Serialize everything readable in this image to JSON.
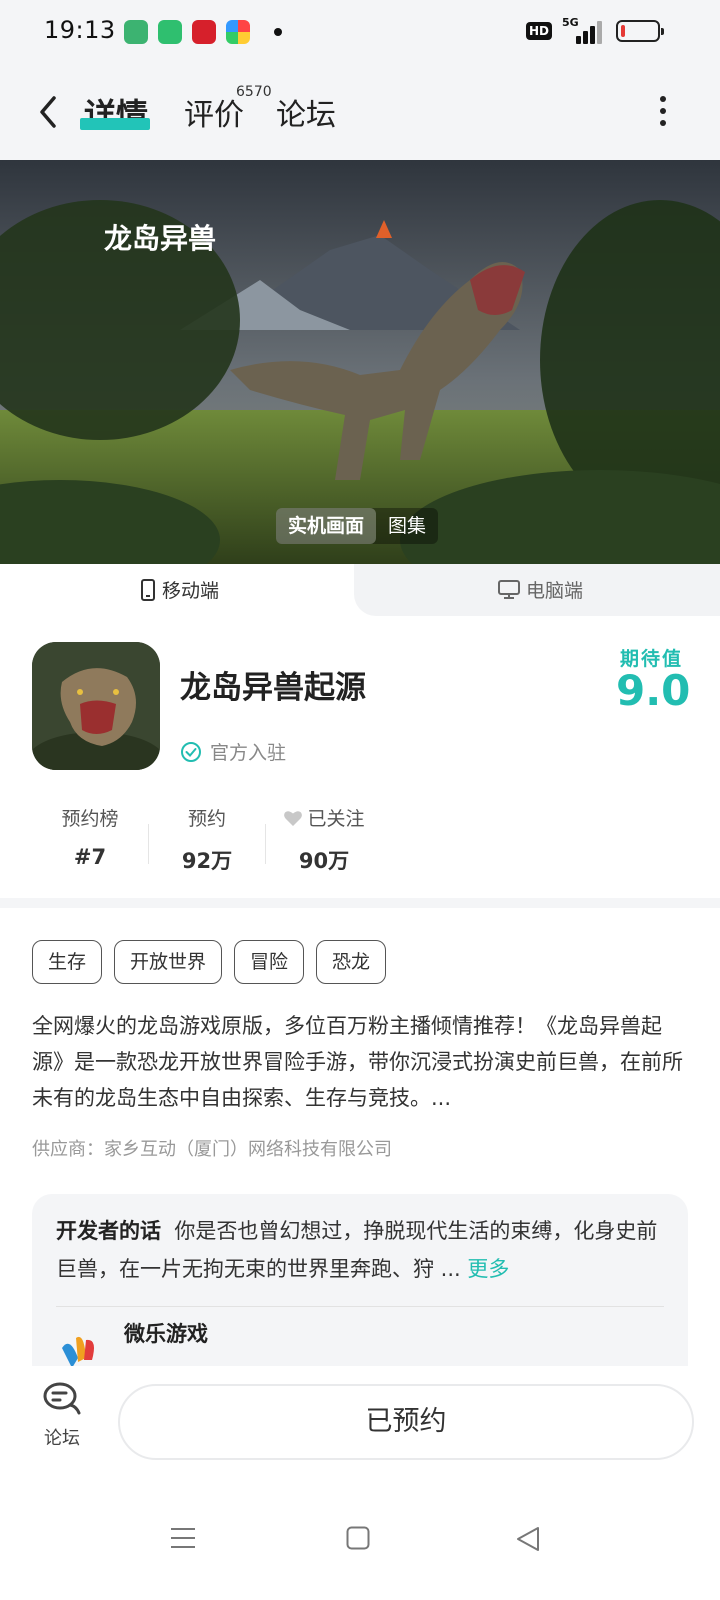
{
  "status_bar": {
    "time": "19:13",
    "hd": "HD",
    "network": "5G",
    "battery_level": 0.1,
    "notification_icons": [
      "app-store-icon",
      "battery-app-icon",
      "red-app-icon",
      "photos-icon"
    ]
  },
  "header": {
    "tabs": [
      {
        "label": "详情",
        "active": true
      },
      {
        "label": "评价"
      },
      {
        "label": "论坛"
      }
    ],
    "review_count": "6570"
  },
  "banner": {
    "toggle": [
      "实机画面",
      "图集"
    ],
    "active_toggle": "实机画面"
  },
  "platform": {
    "mobile": "移动端",
    "pc": "电脑端"
  },
  "app": {
    "name": "龙岛异兽起源",
    "official": "官方入驻",
    "expect_label": "期待值",
    "expect_score": "9.0"
  },
  "stats": [
    {
      "label": "预约榜",
      "value": "#7"
    },
    {
      "label": "预约",
      "value": "92万"
    },
    {
      "label": "已关注",
      "value": "90万"
    }
  ],
  "tags": [
    "生存",
    "开放世界",
    "冒险",
    "恐龙"
  ],
  "description": "全网爆火的龙岛游戏原版，多位百万粉主播倾情推荐！《龙岛异兽起源》是一款恐龙开放世界冒险手游，带你沉浸式扮演史前巨兽，在前所未有的龙岛生态中自由探索、生存与竞技。...",
  "supplier": "供应商：家乡互动（厦门）网络科技有限公司",
  "developer": {
    "title": "开发者的话",
    "text": "你是否也曾幻想过，挣脱现代生活的束缚，化身史前巨兽，在一片无拘无束的世界里奔跑、狩 ...",
    "more": "更多",
    "name": "微乐游戏"
  },
  "bottom": {
    "forum_label": "论坛",
    "reserved_label": "已预约"
  },
  "colors": {
    "accent": "#22bdb1",
    "battery_low": "#e53935"
  }
}
